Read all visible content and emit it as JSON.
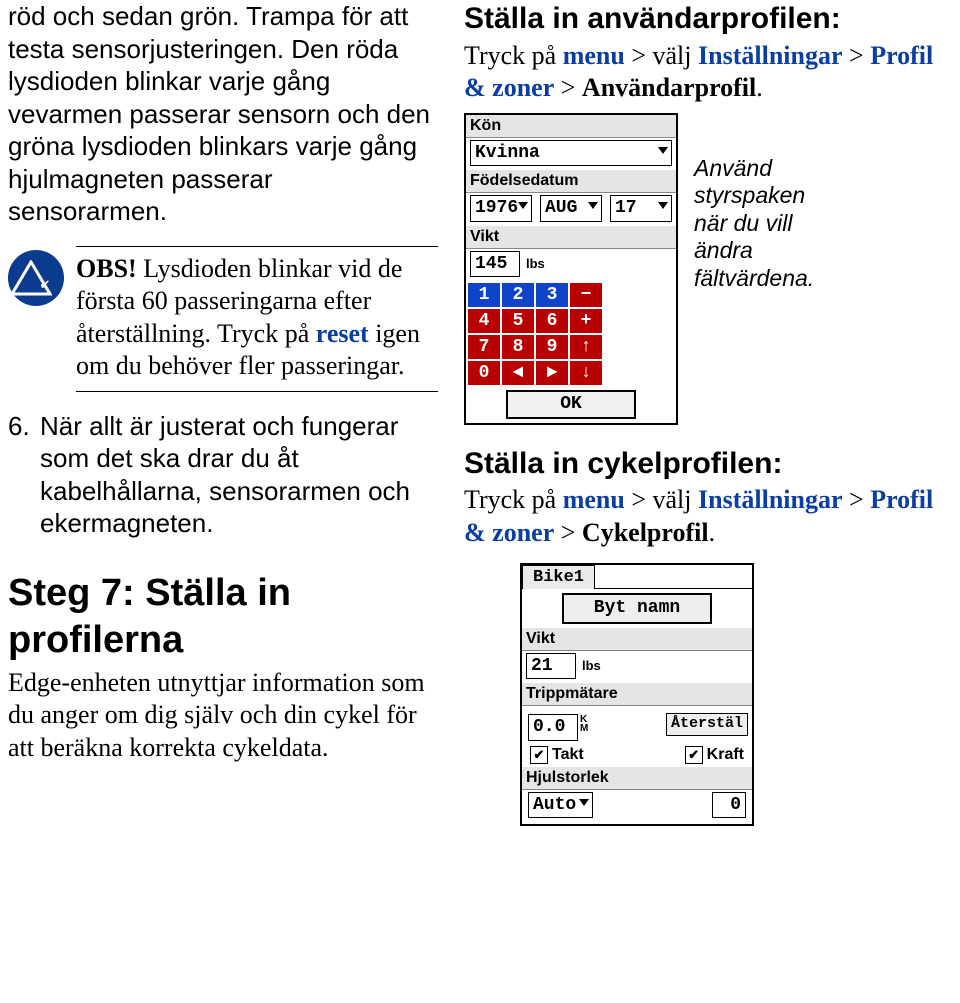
{
  "left": {
    "p1": "röd och sedan grön. Trampa för att testa sensorjusteringen. Den röda lysdioden blinkar varje gång vevarmen passerar sensorn och den gröna lysdioden blinkars varje gång hjulmagneten passerar sensorarmen.",
    "obs_label": "OBS!",
    "obs_text1": " Lysdioden blinkar vid de första 60 passeringarna efter återställning. Tryck på ",
    "obs_reset": "reset",
    "obs_text2": " igen om du behöver fler passeringar.",
    "item6_num": "6.",
    "item6": "När allt är justerat och fungerar som det ska drar du åt kabelhållarna, sensorarmen och ekermagneten.",
    "step_title": "Steg 7: Ställa in profilerna",
    "step_text": "Edge-enheten utnyttjar information som du anger om dig själv och din cykel för att beräkna korrekta cykeldata."
  },
  "right": {
    "user_h": "Ställa in användarprofilen:",
    "user_t1": "Tryck på ",
    "menu": "menu",
    "gt": " > ",
    "valj": "välj ",
    "instl": "Inställningar",
    "pz": "Profil & zoner",
    "ap": "Användarprofil",
    "period": ".",
    "scr1": {
      "kon": "Kön",
      "kon_val": "Kvinna",
      "fd": "Födelsedatum",
      "y": "1976",
      "m": "AUG",
      "d": "17",
      "vikt": "Vikt",
      "vikt_val": "145",
      "vikt_unit": "lbs",
      "keys": [
        [
          "1",
          "2",
          "3",
          "−"
        ],
        [
          "4",
          "5",
          "6",
          "+"
        ],
        [
          "7",
          "8",
          "9",
          "↑"
        ],
        [
          "0",
          "◄",
          "►",
          "↓"
        ]
      ],
      "ok": "OK"
    },
    "side_note": "Använd styrspaken när du vill ändra fältvärdena.",
    "bike_h": "Ställa in cykelprofilen:",
    "bike_t1": "Tryck på ",
    "cp": "Cykelprofil",
    "scr2": {
      "tab": "Bike1",
      "rename": "Byt namn",
      "vikt": "Vikt",
      "vikt_val": "21",
      "vikt_unit": "lbs",
      "trip": "Trippmätare",
      "trip_val": "0.0",
      "trip_unit": "K\nM",
      "reset": "Återstäl",
      "takt": "Takt",
      "kraft": "Kraft",
      "wheel": "Hjulstorlek",
      "wheel_val": "Auto",
      "wheel_num": "0"
    }
  }
}
